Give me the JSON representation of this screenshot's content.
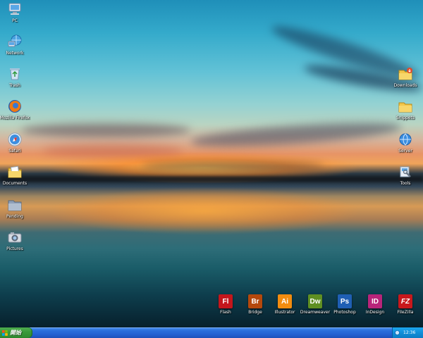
{
  "desktop": {
    "left_icons": [
      {
        "label": "PC",
        "icon": "computer-icon"
      },
      {
        "label": "Network",
        "icon": "network-icon"
      },
      {
        "label": "Trash",
        "icon": "recycle-bin-icon"
      },
      {
        "label": "Mozilla Firefox",
        "icon": "firefox-icon"
      },
      {
        "label": "Safari",
        "icon": "safari-icon"
      },
      {
        "label": "Documents",
        "icon": "documents-folder-icon"
      },
      {
        "label": "Pending",
        "icon": "pending-folder-icon"
      },
      {
        "label": "Pictures",
        "icon": "pictures-icon"
      }
    ],
    "right_icons": [
      {
        "label": "Downloads",
        "icon": "downloads-folder-icon"
      },
      {
        "label": "Snippets",
        "icon": "snippets-folder-icon"
      },
      {
        "label": "Server",
        "icon": "server-icon"
      },
      {
        "label": "Tools",
        "icon": "tools-icon"
      }
    ],
    "app_icons": [
      {
        "abbr": "Fl",
        "label": "Flash",
        "color": "#c4161c"
      },
      {
        "abbr": "Br",
        "label": "Bridge",
        "color": "#b5480c"
      },
      {
        "abbr": "Ai",
        "label": "Illustrator",
        "color": "#f28c0f"
      },
      {
        "abbr": "Dw",
        "label": "Dreamweaver",
        "color": "#5f8f22"
      },
      {
        "abbr": "Ps",
        "label": "Photoshop",
        "color": "#1f5fb4"
      },
      {
        "abbr": "ID",
        "label": "InDesign",
        "color": "#b8247a"
      },
      {
        "abbr": "FZ",
        "label": "FileZilla",
        "color": "#c8181c"
      }
    ]
  },
  "taskbar": {
    "start_label": "開始",
    "clock": "12:36"
  }
}
